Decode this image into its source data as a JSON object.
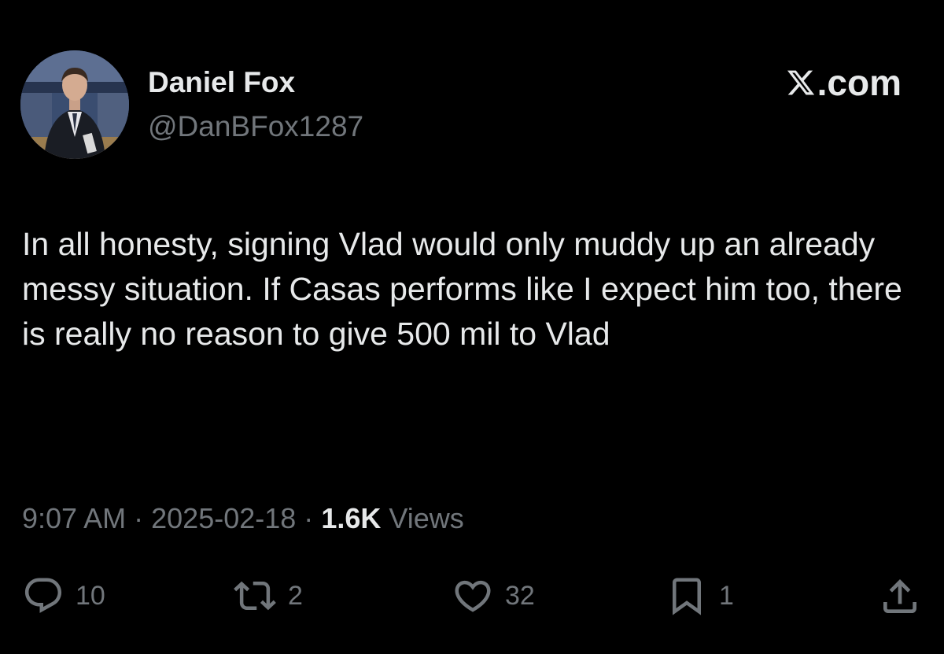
{
  "author": {
    "display_name": "Daniel Fox",
    "handle": "@DanBFox1287"
  },
  "site_mark": {
    "icon": "x-logo-icon",
    "label": ".com"
  },
  "tweet": {
    "text": "In all honesty, signing Vlad would only muddy up an already messy situation. If Casas performs like I expect him too, there is really no reason to give 500 mil to Vlad"
  },
  "meta": {
    "time": "9:07 AM",
    "separator": "·",
    "date": "2025-02-18",
    "views_count": "1.6K",
    "views_label": "Views"
  },
  "actions": {
    "reply": {
      "icon": "reply-icon",
      "count": "10"
    },
    "retweet": {
      "icon": "retweet-icon",
      "count": "2"
    },
    "like": {
      "icon": "heart-icon",
      "count": "32"
    },
    "bookmark": {
      "icon": "bookmark-icon",
      "count": "1"
    },
    "share": {
      "icon": "share-icon"
    }
  },
  "colors": {
    "background": "#000000",
    "primary_text": "#e7e9ea",
    "secondary_text": "#71767b"
  }
}
